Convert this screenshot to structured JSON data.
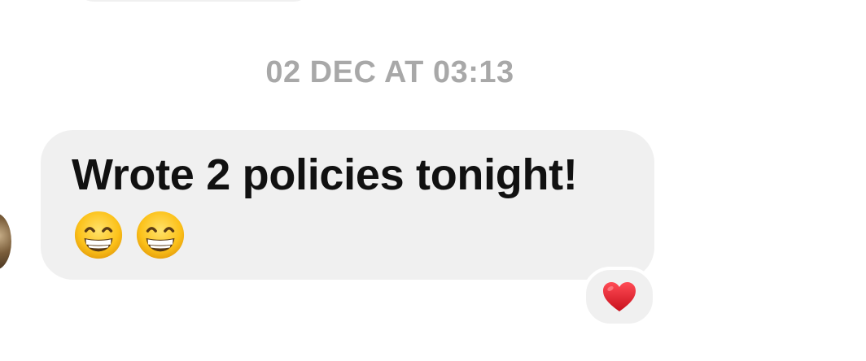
{
  "thread": {
    "timestamp": "02 DEC AT 03:13"
  },
  "message": {
    "text": "Wrote 2 policies tonight!",
    "emojis": [
      "beaming-face-icon",
      "beaming-face-icon"
    ]
  },
  "reaction": {
    "icon": "red-heart-icon",
    "color": "#e0242e"
  },
  "colors": {
    "bubble": "#f0f0f0",
    "timestamp": "#a8a8a8",
    "text": "#111111"
  }
}
